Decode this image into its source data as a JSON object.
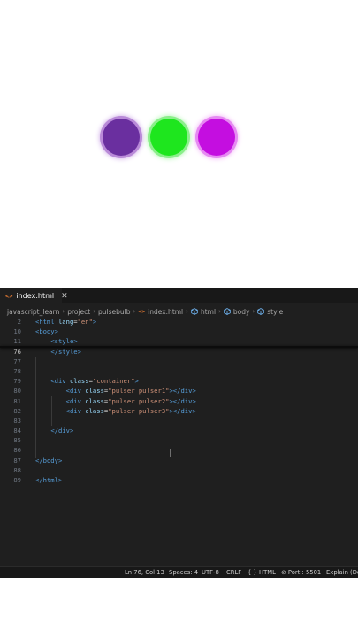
{
  "colors": {
    "bulb1": "#6a2f9f",
    "bulb2": "#1ee61e",
    "bulb3": "#c40ee0",
    "editor_bg": "#1f1f1f",
    "tab_accent": "#0078d4"
  },
  "tab": {
    "icon": "html-file-icon",
    "filename": "index.html",
    "close_glyph": "✕"
  },
  "breadcrumb": [
    "javascript_learn",
    "project",
    "pulsebulb",
    "index.html",
    "html",
    "body",
    "style"
  ],
  "code_lines": [
    {
      "n": "2",
      "html": "<span class='tag'>&lt;html</span> <span class='attr'>lang</span><span class='plain'>=</span><span class='str'>\"en\"</span><span class='tag'>&gt;</span>"
    },
    {
      "n": "10",
      "html": "<span class='tag'>&lt;body&gt;</span>"
    },
    {
      "n": "11",
      "html": "    <span class='tag'>&lt;style&gt;</span>"
    },
    {
      "n": "76",
      "html": "    <span class='tag'>&lt;/style&gt;</span>",
      "active": true
    },
    {
      "n": "77",
      "html": ""
    },
    {
      "n": "78",
      "html": ""
    },
    {
      "n": "79",
      "html": "    <span class='tag'>&lt;div</span> <span class='attr'>class</span><span class='plain'>=</span><span class='str'>\"container\"</span><span class='tag'>&gt;</span>"
    },
    {
      "n": "80",
      "html": "        <span class='tag'>&lt;div</span> <span class='attr'>class</span><span class='plain'>=</span><span class='str'>\"pulser pulser1\"</span><span class='tag'>&gt;&lt;/div&gt;</span>"
    },
    {
      "n": "81",
      "html": "        <span class='tag'>&lt;div</span> <span class='attr'>class</span><span class='plain'>=</span><span class='str'>\"pulser pulser2\"</span><span class='tag'>&gt;&lt;/div&gt;</span>"
    },
    {
      "n": "82",
      "html": "        <span class='tag'>&lt;div</span> <span class='attr'>class</span><span class='plain'>=</span><span class='str'>\"pulser pulser3\"</span><span class='tag'>&gt;&lt;/div&gt;</span>"
    },
    {
      "n": "83",
      "html": ""
    },
    {
      "n": "84",
      "html": "    <span class='tag'>&lt;/div&gt;</span>"
    },
    {
      "n": "85",
      "html": ""
    },
    {
      "n": "86",
      "html": ""
    },
    {
      "n": "87",
      "html": "<span class='tag'>&lt;/body&gt;</span>"
    },
    {
      "n": "88",
      "html": ""
    },
    {
      "n": "89",
      "html": "<span class='tag'>&lt;/html&gt;</span>"
    }
  ],
  "status": {
    "position": "Ln 76, Col 13",
    "spaces": "Spaces: 4",
    "encoding": "UTF-8",
    "eol": "CRLF",
    "language": "{ } HTML",
    "port": "⊘ Port : 5501",
    "explain": "Explain (De"
  }
}
